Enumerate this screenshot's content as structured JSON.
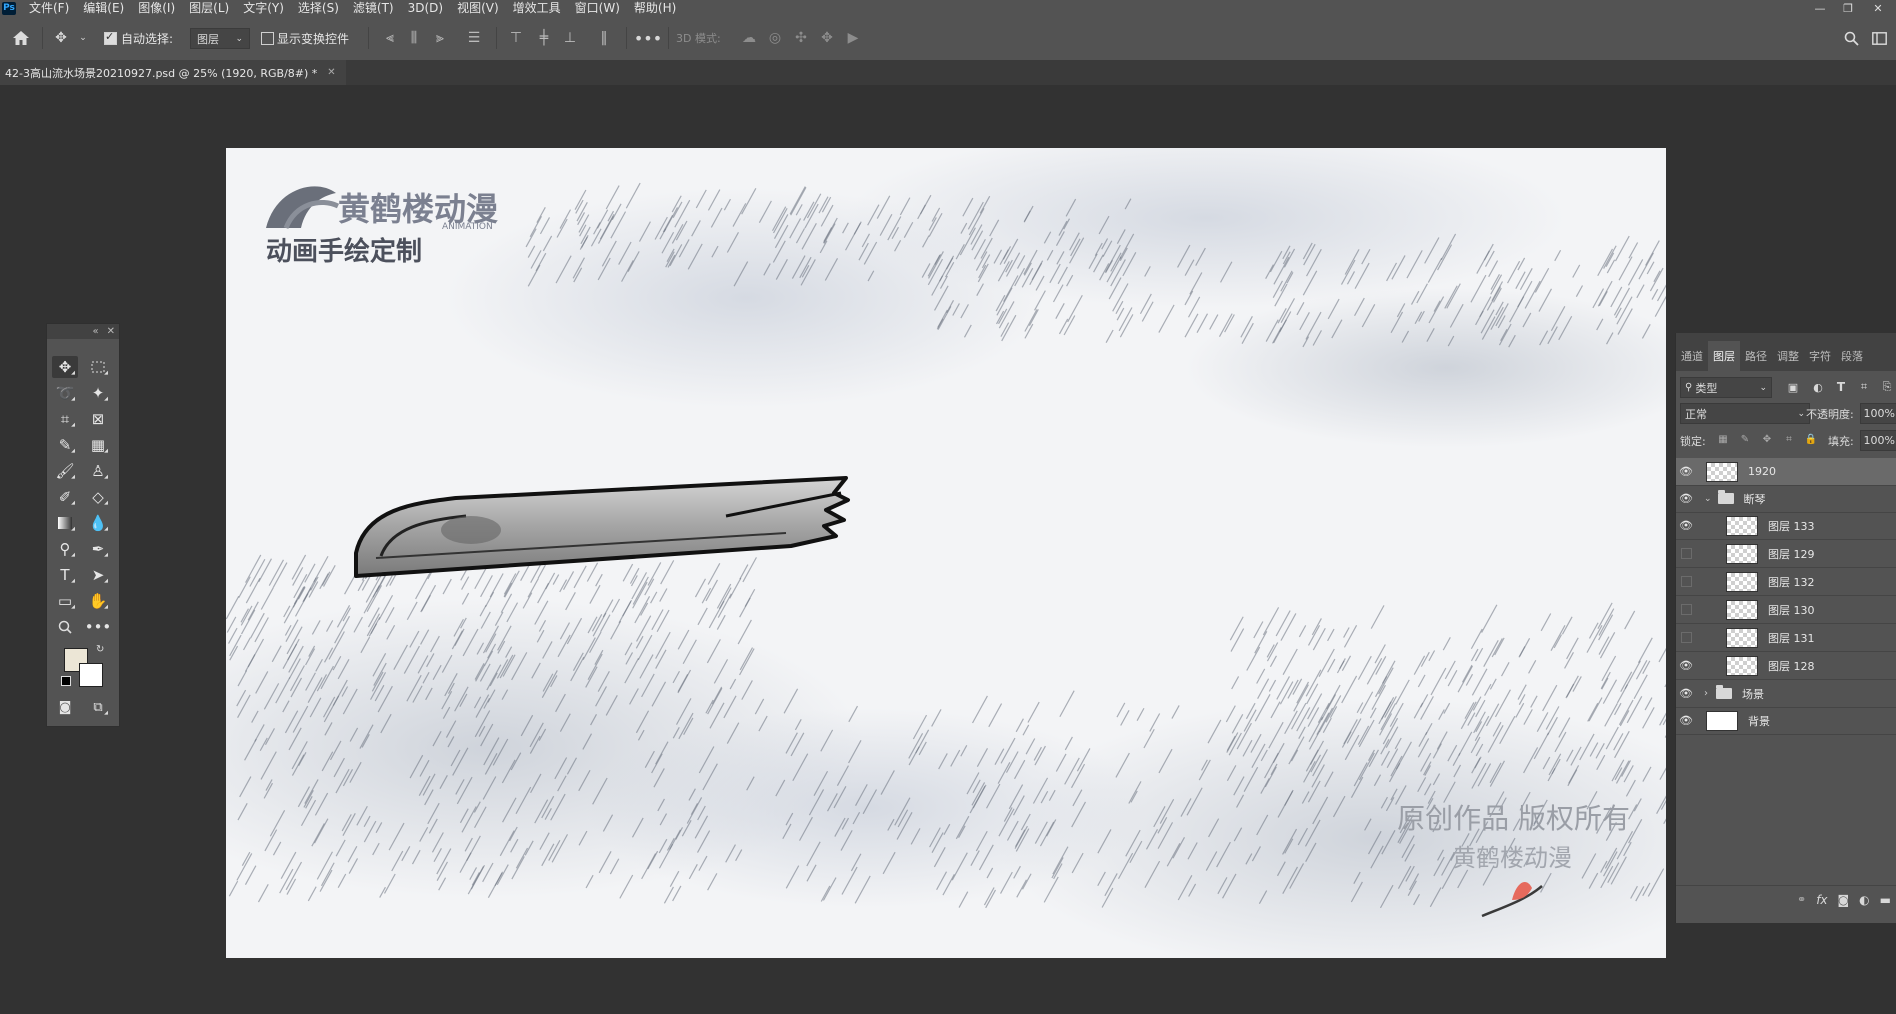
{
  "menubar": {
    "logo": "Ps",
    "items": [
      "文件(F)",
      "编辑(E)",
      "图像(I)",
      "图层(L)",
      "文字(Y)",
      "选择(S)",
      "滤镜(T)",
      "3D(D)",
      "视图(V)",
      "增效工具",
      "窗口(W)",
      "帮助(H)"
    ]
  },
  "options": {
    "auto_select_label": "自动选择:",
    "auto_select_value": "图层",
    "show_transform_label": "显示变换控件",
    "mode_3d_label": "3D 模式:"
  },
  "document": {
    "tab_title": "42-3高山流水场景20210927.psd @ 25% (1920, RGB/8#) *"
  },
  "canvas_art": {
    "logo_brand": "黄鹤楼动漫",
    "logo_animation": "ANIMATION",
    "logo_slogan": "动画手绘定制",
    "watermark_line1": "原创作品 版权所有",
    "watermark_line2": "黄鹤楼动漫"
  },
  "layers_panel": {
    "tabs": [
      "通道",
      "图层",
      "路径",
      "调整",
      "字符",
      "段落"
    ],
    "active_tab": "图层",
    "filter_kind": "类型",
    "blend_mode": "正常",
    "opacity_label": "不透明度:",
    "opacity_value": "100%",
    "lock_label": "锁定:",
    "fill_label": "填充:",
    "fill_value": "100%",
    "layers": [
      {
        "name": "1920",
        "visible": true,
        "selected": true
      },
      {
        "name": "断琴",
        "visible": true,
        "group": true,
        "expanded": true
      },
      {
        "name": "图层 133",
        "visible": true
      },
      {
        "name": "图层 129",
        "visible": false
      },
      {
        "name": "图层 132",
        "visible": false
      },
      {
        "name": "图层 130",
        "visible": false
      },
      {
        "name": "图层 131",
        "visible": false
      },
      {
        "name": "图层 128",
        "visible": true
      },
      {
        "name": "场景",
        "visible": true,
        "group": true,
        "expanded": false
      },
      {
        "name": "背景",
        "visible": true
      }
    ],
    "footer_fx": "fx"
  },
  "colors": {
    "foreground": "#ece6d6",
    "background": "#ffffff"
  }
}
